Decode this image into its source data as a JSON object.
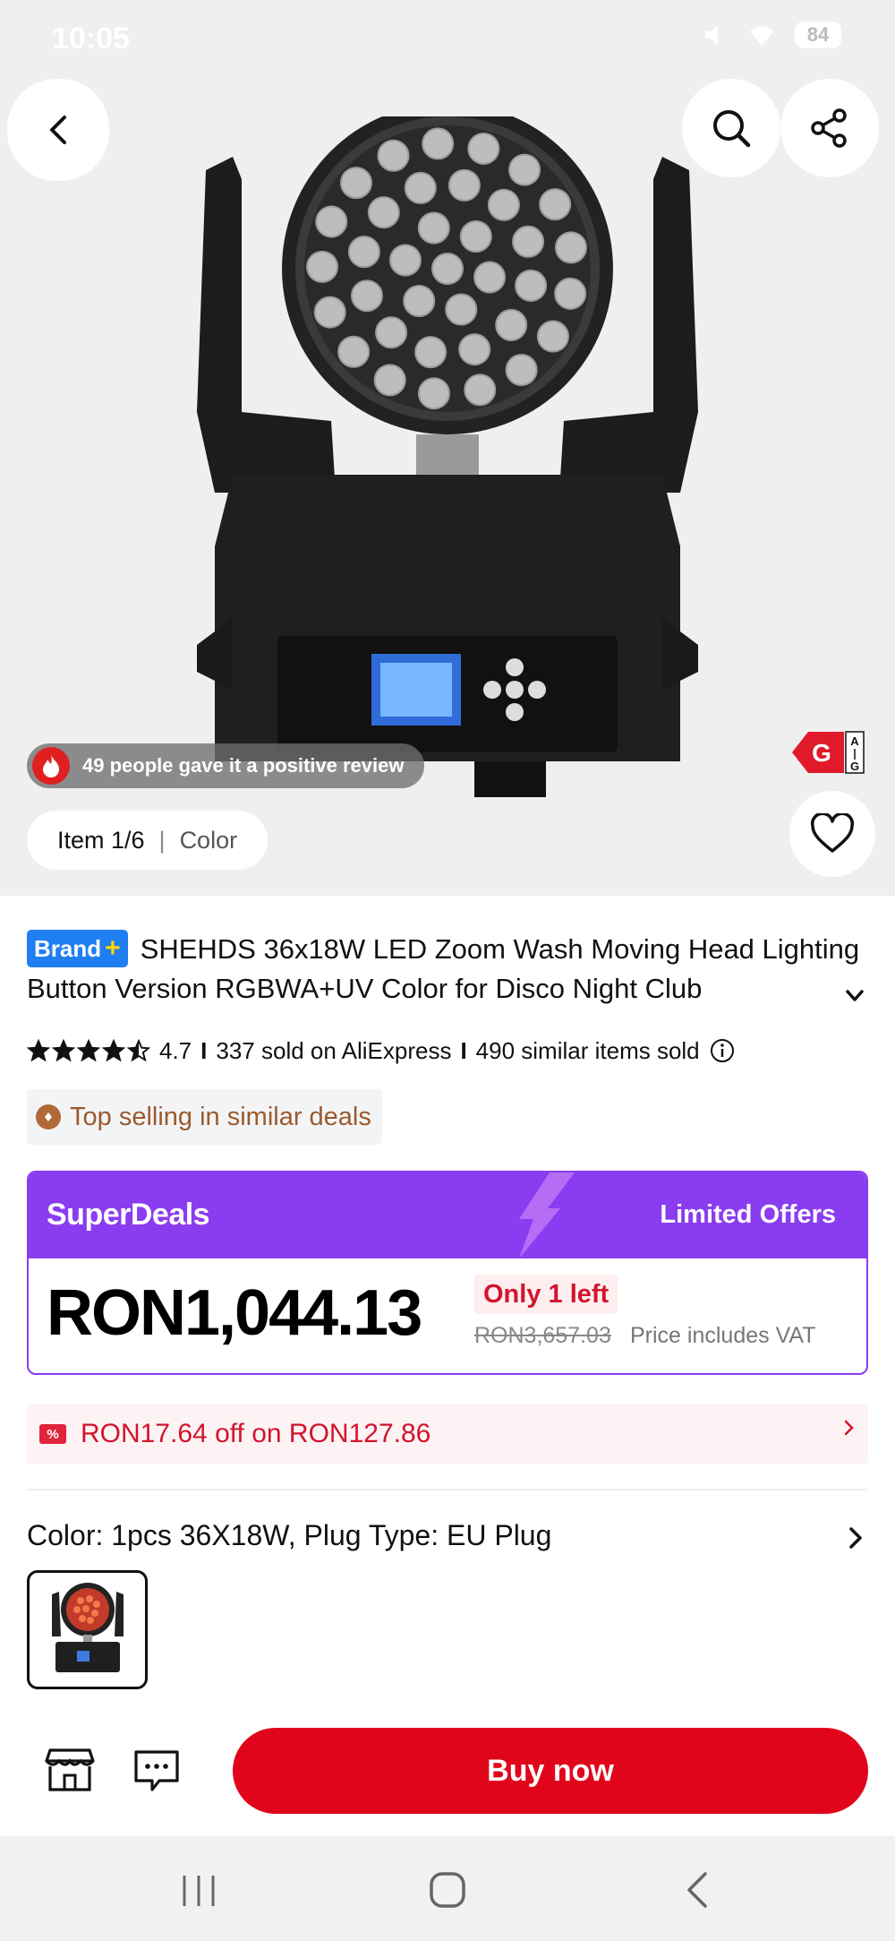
{
  "status_bar": {
    "time": "10:05",
    "battery": "84"
  },
  "gallery": {
    "review_banner": "49 people gave it a positive review",
    "item_indicator": "Item 1/6",
    "color_tab": "Color",
    "energy_label": {
      "class": "G",
      "scale_top": "A",
      "scale_bottom": "G"
    }
  },
  "product": {
    "brand_badge": "Brand",
    "brand_badge_plus": "+",
    "title": "SHEHDS 36x18W LED Zoom Wash Moving Head Lighting Button Version RGBWA+UV Color for Disco Night Club",
    "rating": "4.7",
    "rating_stars": 4.5,
    "sold": "337 sold on AliExpress",
    "similar_sold": "490 similar items sold",
    "top_selling": "Top selling in similar deals"
  },
  "superdeals": {
    "title": "SuperDeals",
    "offers_label": "Limited Offers",
    "price": "RON1,044.13",
    "stock_badge": "Only 1 left",
    "original_price": "RON3,657.03",
    "vat_note": "Price includes VAT"
  },
  "coupon": {
    "icon": "%",
    "text": "RON17.64 off on RON127.86"
  },
  "variant": {
    "summary": "Color: 1pcs 36X18W, Plug Type: EU Plug"
  },
  "actions": {
    "buy_now": "Buy now"
  },
  "icons": {
    "back": "back-arrow-icon",
    "search": "search-icon",
    "share": "share-icon",
    "favorite": "heart-icon",
    "store": "store-icon",
    "chat": "chat-icon",
    "info": "info-icon",
    "fire": "fire-icon",
    "medal": "medal-icon"
  },
  "colors": {
    "accent_red": "#e1051c",
    "superdeals_purple": "#8a3cf0",
    "brand_blue": "#1f7ff2",
    "top_selling_brown": "#9b5a2c"
  }
}
